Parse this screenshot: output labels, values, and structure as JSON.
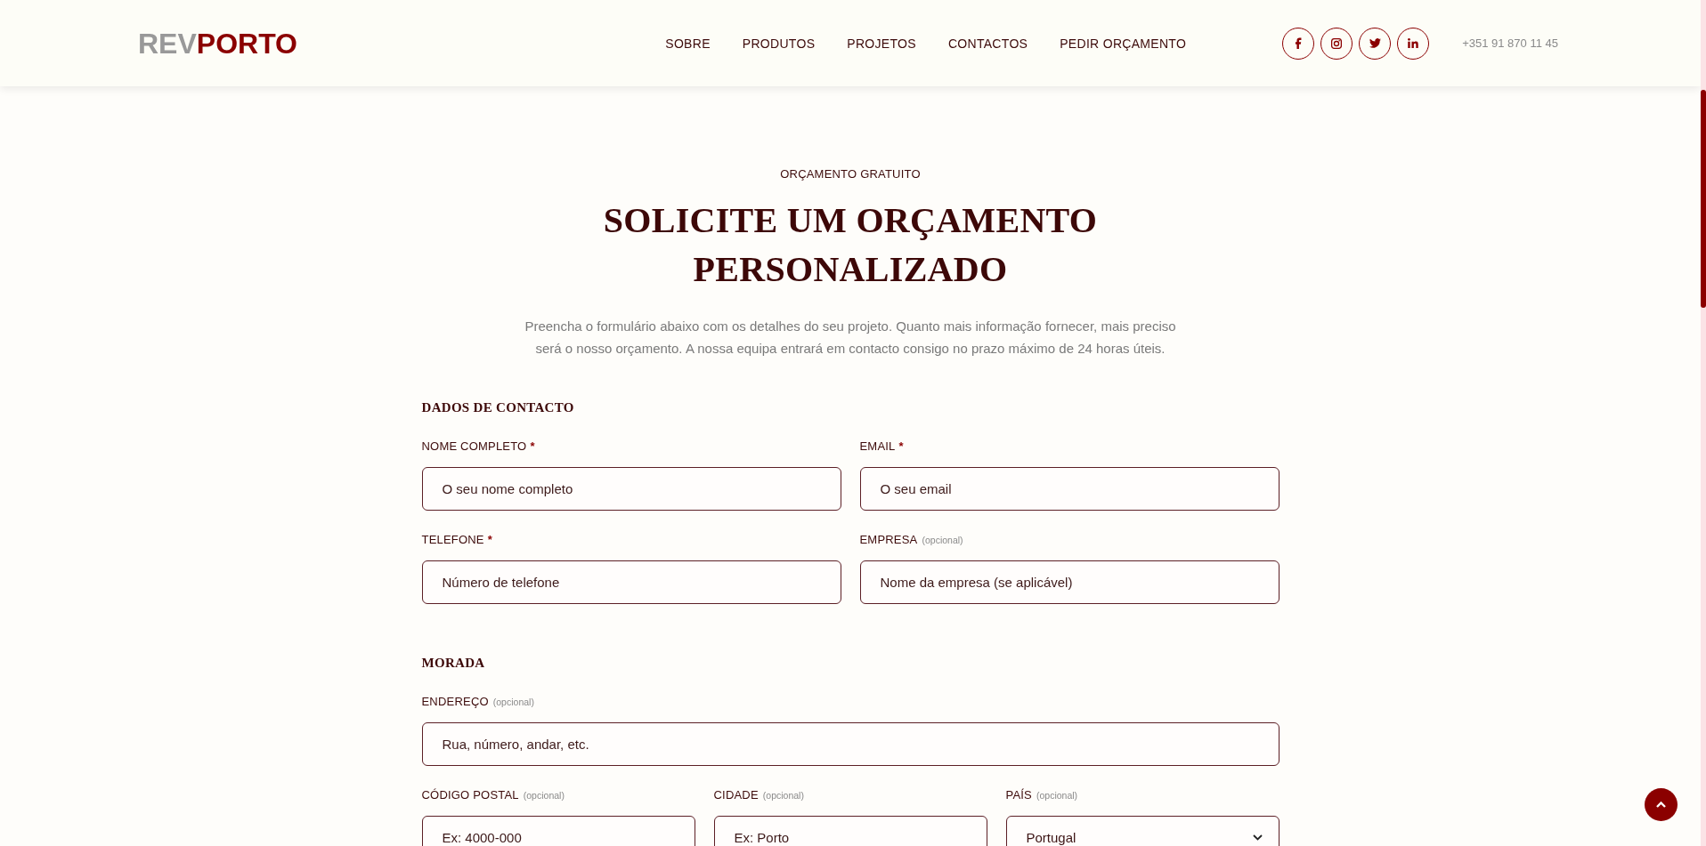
{
  "header": {
    "logo": {
      "prefix": "REV",
      "suffix": "PORTO"
    },
    "nav": [
      {
        "label": "SOBRE"
      },
      {
        "label": "PRODUTOS"
      },
      {
        "label": "PROJETOS"
      },
      {
        "label": "CONTACTOS"
      },
      {
        "label": "PEDIR ORÇAMENTO"
      }
    ],
    "phone": "+351 91 870 11 45"
  },
  "intro": {
    "eyebrow": "ORÇAMENTO GRATUITO",
    "title": "SOLICITE UM ORÇAMENTO PERSONALIZADO",
    "description": "Preencha o formulário abaixo com os detalhes do seu projeto. Quanto mais informação fornecer, mais preciso será o nosso orçamento. A nossa equipa entrará em contacto consigo no prazo máximo de 24 horas úteis."
  },
  "form": {
    "sections": [
      {
        "title": "DADOS DE CONTACTO",
        "rows": [
          {
            "fields": [
              {
                "kind": "text",
                "label": "NOME COMPLETO",
                "required_mark": "*",
                "placeholder": "O seu nome completo"
              },
              {
                "kind": "text",
                "label": "EMAIL",
                "required_mark": "*",
                "placeholder": "O seu email"
              }
            ]
          },
          {
            "fields": [
              {
                "kind": "text",
                "label": "TELEFONE",
                "required_mark": "*",
                "placeholder": "Número de telefone"
              },
              {
                "kind": "text",
                "label": "EMPRESA",
                "hint": "(opcional)",
                "placeholder": "Nome da empresa (se aplicável)"
              }
            ]
          }
        ]
      },
      {
        "title": "MORADA",
        "rows": [
          {
            "fields": [
              {
                "kind": "text",
                "label": "ENDEREÇO",
                "hint": "(opcional)",
                "placeholder": "Rua, número, andar, etc."
              }
            ]
          },
          {
            "fields": [
              {
                "kind": "text",
                "label": "CÓDIGO POSTAL",
                "hint": "(opcional)",
                "placeholder": "Ex: 4000-000"
              },
              {
                "kind": "text",
                "label": "CIDADE",
                "hint": "(opcional)",
                "placeholder": "Ex: Porto"
              },
              {
                "kind": "select",
                "label": "PAÍS",
                "hint": "(opcional)",
                "value": "Portugal"
              }
            ]
          }
        ]
      }
    ]
  }
}
